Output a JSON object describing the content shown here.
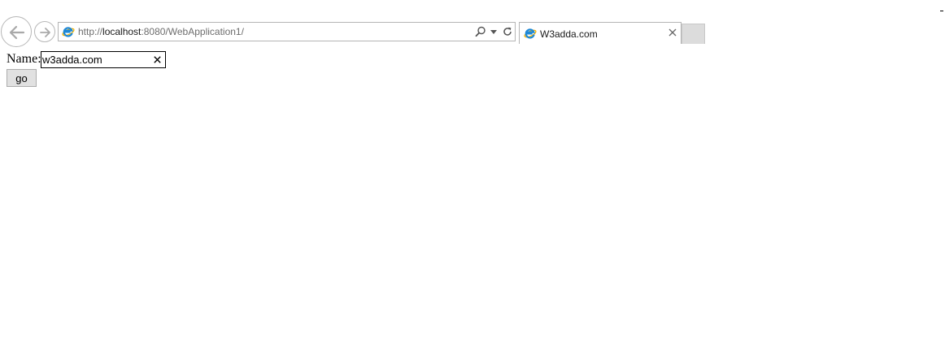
{
  "browser": {
    "address_bar": {
      "url_scheme": "http://",
      "url_host": "localhost",
      "url_rest": ":8080/WebApplication1/"
    },
    "tab": {
      "title": "W3adda.com",
      "close_glyph": "×"
    }
  },
  "icons": {
    "back": "back-arrow-icon",
    "forward": "forward-arrow-icon",
    "site": "ie-logo-icon",
    "search": "search-icon",
    "dropdown": "chevron-down-icon",
    "refresh": "refresh-icon",
    "close": "close-icon"
  },
  "form": {
    "label": "Name:",
    "name_value": "w3adda.com",
    "button_label": "go"
  },
  "colors": {
    "ie_blue": "#1e88d6",
    "ie_gold": "#f4b400",
    "button_bg": "#e1e1e1",
    "new_tab_bg": "#dcdcdc"
  }
}
